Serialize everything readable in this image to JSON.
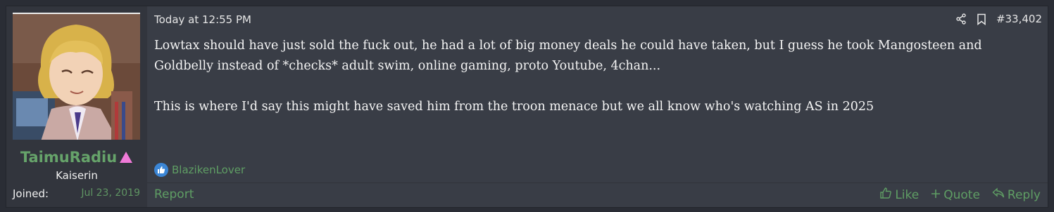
{
  "user": {
    "name": "TaimuRadiu",
    "title": "Kaiserin",
    "joined_label": "Joined:",
    "joined_date": "Jul 23, 2019",
    "name_color": "#66a36a",
    "badge_color": "#f07ad8"
  },
  "post": {
    "date": "Today at 12:55 PM",
    "number": "#33,402",
    "paragraph1": "Lowtax should have just sold the fuck out, he had a lot of big money deals he could have taken, but I guess he took Mangosteen and Goldbelly instead of *checks* adult swim, online gaming, proto Youtube, 4chan...",
    "paragraph2": "This is where I'd say this might have saved him from the troon menace but we all know who's watching AS in 2025",
    "icons": {
      "share": "share-icon",
      "bookmark": "bookmark-icon"
    }
  },
  "reactions": {
    "icon": "thumbs-up-icon",
    "user": "BlazikenLover"
  },
  "footer": {
    "report": "Report",
    "like": "Like",
    "quote": "Quote",
    "reply": "Reply"
  }
}
